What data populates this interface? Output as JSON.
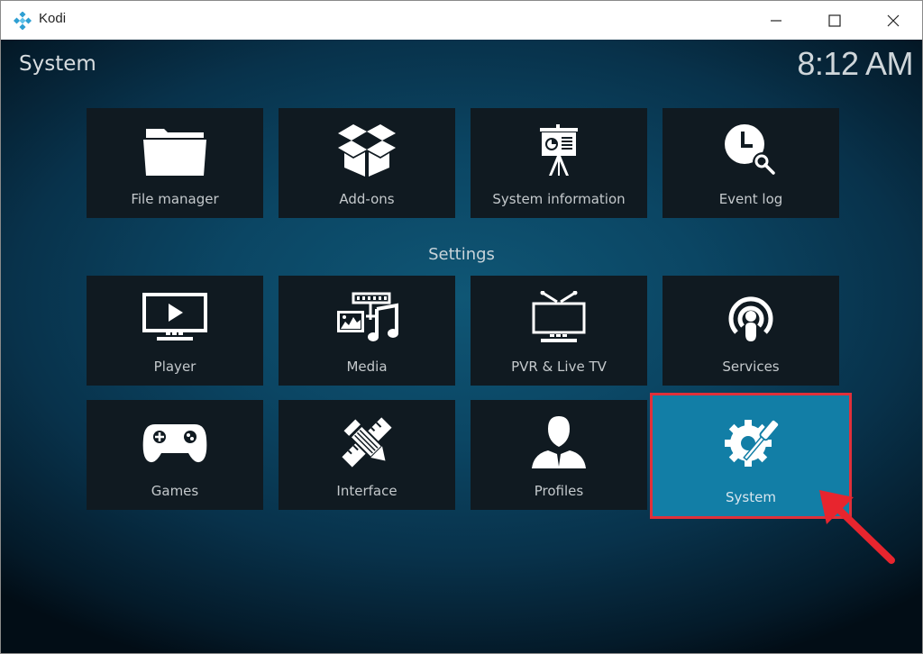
{
  "window": {
    "title": "Kodi",
    "controls": {
      "minimize": "minimize",
      "maximize": "maximize",
      "close": "close"
    }
  },
  "header": {
    "title": "System",
    "clock": "8:12 AM"
  },
  "top_row": [
    {
      "label": "File manager",
      "icon": "folder-icon"
    },
    {
      "label": "Add-ons",
      "icon": "open-box-icon"
    },
    {
      "label": "System information",
      "icon": "presentation-board-icon"
    },
    {
      "label": "Event log",
      "icon": "clock-search-icon"
    }
  ],
  "settings": {
    "heading": "Settings",
    "items": [
      {
        "label": "Player",
        "icon": "monitor-play-icon"
      },
      {
        "label": "Media",
        "icon": "media-icon"
      },
      {
        "label": "PVR & Live TV",
        "icon": "tv-antenna-icon"
      },
      {
        "label": "Services",
        "icon": "broadcast-icon"
      },
      {
        "label": "Games",
        "icon": "gamepad-icon"
      },
      {
        "label": "Interface",
        "icon": "pencil-ruler-icon"
      },
      {
        "label": "Profiles",
        "icon": "user-icon"
      },
      {
        "label": "System",
        "icon": "gear-screwdriver-icon",
        "focused": true
      }
    ]
  },
  "annotation": {
    "highlight_color": "#e0303a",
    "target": "System"
  },
  "colors": {
    "focus": "#127ea6",
    "tile": "#101a21"
  }
}
